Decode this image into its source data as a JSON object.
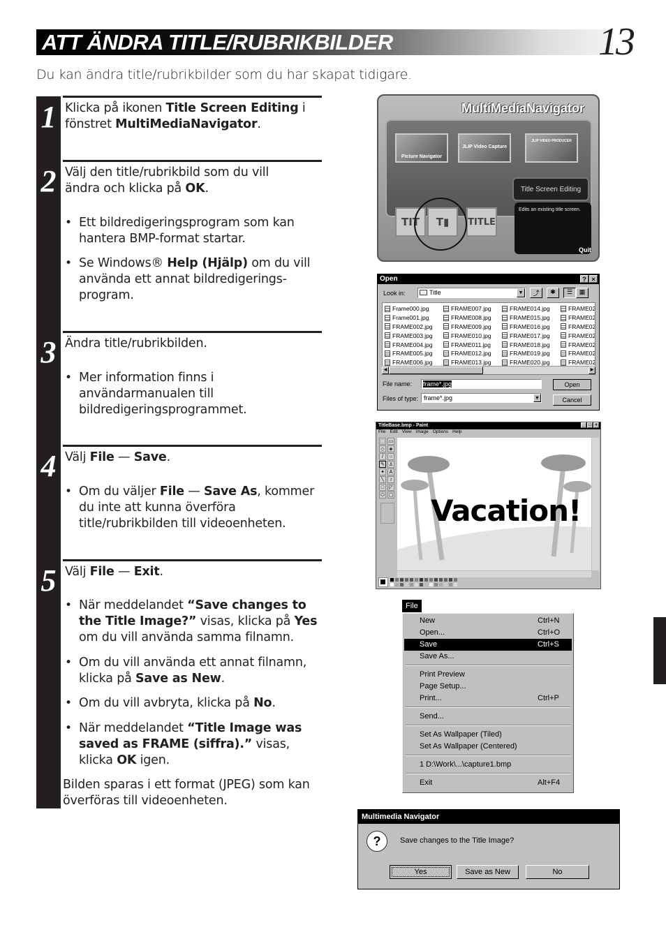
{
  "header": {
    "title": "ATT ÄNDRA TITLE/RUBRIKBILDER",
    "page_number": "13"
  },
  "intro": "Du kan ändra title/rubrikbilder som du har skapat tidigare.",
  "steps": [
    {
      "number": "1",
      "text_parts": [
        "Klicka på ikonen ",
        "Title Screen Editing",
        " i fönstret ",
        "MultiMediaNavigator",
        "."
      ]
    },
    {
      "number": "2",
      "text_parts": [
        "Välj den title/rubrikbild som du vill ändra och klicka på ",
        "OK",
        "."
      ],
      "bullets": [
        {
          "parts": [
            "Ett bildredigeringsprogram som kan hantera BMP-format startar."
          ]
        },
        {
          "parts": [
            "Se Windows® ",
            "Help (Hjälp)",
            " om du vill använda ett annat bildredigerings-program."
          ]
        }
      ]
    },
    {
      "number": "3",
      "text_parts": [
        "Ändra title/rubrikbilden."
      ],
      "bullets": [
        {
          "parts": [
            "Mer information finns i användarmanualen till bildredigeringsprogrammet."
          ]
        }
      ]
    },
    {
      "number": "4",
      "text_parts": [
        "Välj ",
        "File",
        " — ",
        "Save",
        "."
      ],
      "bullets": [
        {
          "parts": [
            "Om du väljer ",
            "File",
            " — ",
            "Save As",
            ", kommer du inte att kunna överföra title/rubrikbilden till videoenheten."
          ]
        }
      ]
    },
    {
      "number": "5",
      "text_parts": [
        "Välj ",
        "File",
        " — ",
        "Exit",
        "."
      ],
      "bullets": [
        {
          "parts": [
            "När meddelandet ",
            "“Save changes to the Title Image?”",
            " visas, klicka på ",
            "Yes",
            " om du vill använda samma filnamn."
          ]
        },
        {
          "parts": [
            "Om du vill använda ett annat filnamn, klicka på ",
            "Save as New",
            "."
          ]
        },
        {
          "parts": [
            "Om du vill avbryta, klicka på ",
            "No",
            "."
          ]
        },
        {
          "parts": [
            "När meddelandet ",
            "“Title Image was saved as FRAME (siffra).”",
            " visas, klicka ",
            "OK",
            " igen."
          ]
        }
      ],
      "footer": "Bilden sparas i ett format (JPEG) som kan överföras till videoenheten."
    }
  ],
  "mmn_window": {
    "title": "MultiMediaNavigator",
    "apps": [
      "Picture Navigator",
      "JLIP Video Capture",
      "JLIP VIDEO PRODUCER"
    ],
    "selected_label": "Title Screen Editing",
    "icons": [
      "TITLE (new)",
      "TITLE (edit)",
      "TITLE (play)"
    ],
    "description": "Edits an existing title screen.",
    "quit": "Quit"
  },
  "open_dialog": {
    "title": "Open",
    "look_in_label": "Look in:",
    "look_in_value": "Title",
    "files": [
      [
        "Frame000.jpg",
        "Frame001.jpg",
        "FRAME002.jpg",
        "FRAME003.jpg",
        "FRAME004.jpg",
        "FRAME005.jpg",
        "FRAME006.jpg"
      ],
      [
        "FRAME007.jpg",
        "FRAME008.jpg",
        "FRAME009.jpg",
        "FRAME010.jpg",
        "FRAME011.jpg",
        "FRAME012.jpg",
        "FRAME013.jpg"
      ],
      [
        "FRAME014.jpg",
        "FRAME015.jpg",
        "FRAME016.jpg",
        "FRAME017.jpg",
        "FRAME018.jpg",
        "FRAME019.jpg",
        "FRAME020.jpg"
      ],
      [
        "FRAME02",
        "FRAME02",
        "FRAME02",
        "FRAME02",
        "FRAME02",
        "FRAME02",
        "FRAME02"
      ]
    ],
    "file_name_label": "File name:",
    "file_name_value": "frame*.jpg",
    "file_type_label": "Files of type:",
    "file_type_value": "frame*.jpg",
    "open_button": "Open",
    "cancel_button": "Cancel"
  },
  "paint_window": {
    "title": "TitleBase.bmp - Paint",
    "menu": [
      "File",
      "Edit",
      "View",
      "Image",
      "Options",
      "Help"
    ],
    "canvas_text": "Vacation!"
  },
  "file_menu": {
    "label": "File",
    "items": [
      {
        "label": "New",
        "shortcut": "Ctrl+N"
      },
      {
        "label": "Open...",
        "shortcut": "Ctrl+O"
      },
      {
        "label": "Save",
        "shortcut": "Ctrl+S",
        "selected": true
      },
      {
        "label": "Save As...",
        "shortcut": ""
      },
      {
        "label": "Print Preview",
        "shortcut": ""
      },
      {
        "label": "Page Setup...",
        "shortcut": ""
      },
      {
        "label": "Print...",
        "shortcut": "Ctrl+P"
      },
      {
        "label": "Send...",
        "shortcut": ""
      },
      {
        "label": "Set As Wallpaper (Tiled)",
        "shortcut": ""
      },
      {
        "label": "Set As Wallpaper (Centered)",
        "shortcut": ""
      },
      {
        "label": "1 D:\\Work\\...\\capture1.bmp",
        "shortcut": ""
      },
      {
        "label": "Exit",
        "shortcut": "Alt+F4"
      }
    ]
  },
  "save_dialog": {
    "title": "Multimedia Navigator",
    "message": "Save changes to the Title Image?",
    "buttons": [
      "Yes",
      "Save as New",
      "No"
    ]
  }
}
